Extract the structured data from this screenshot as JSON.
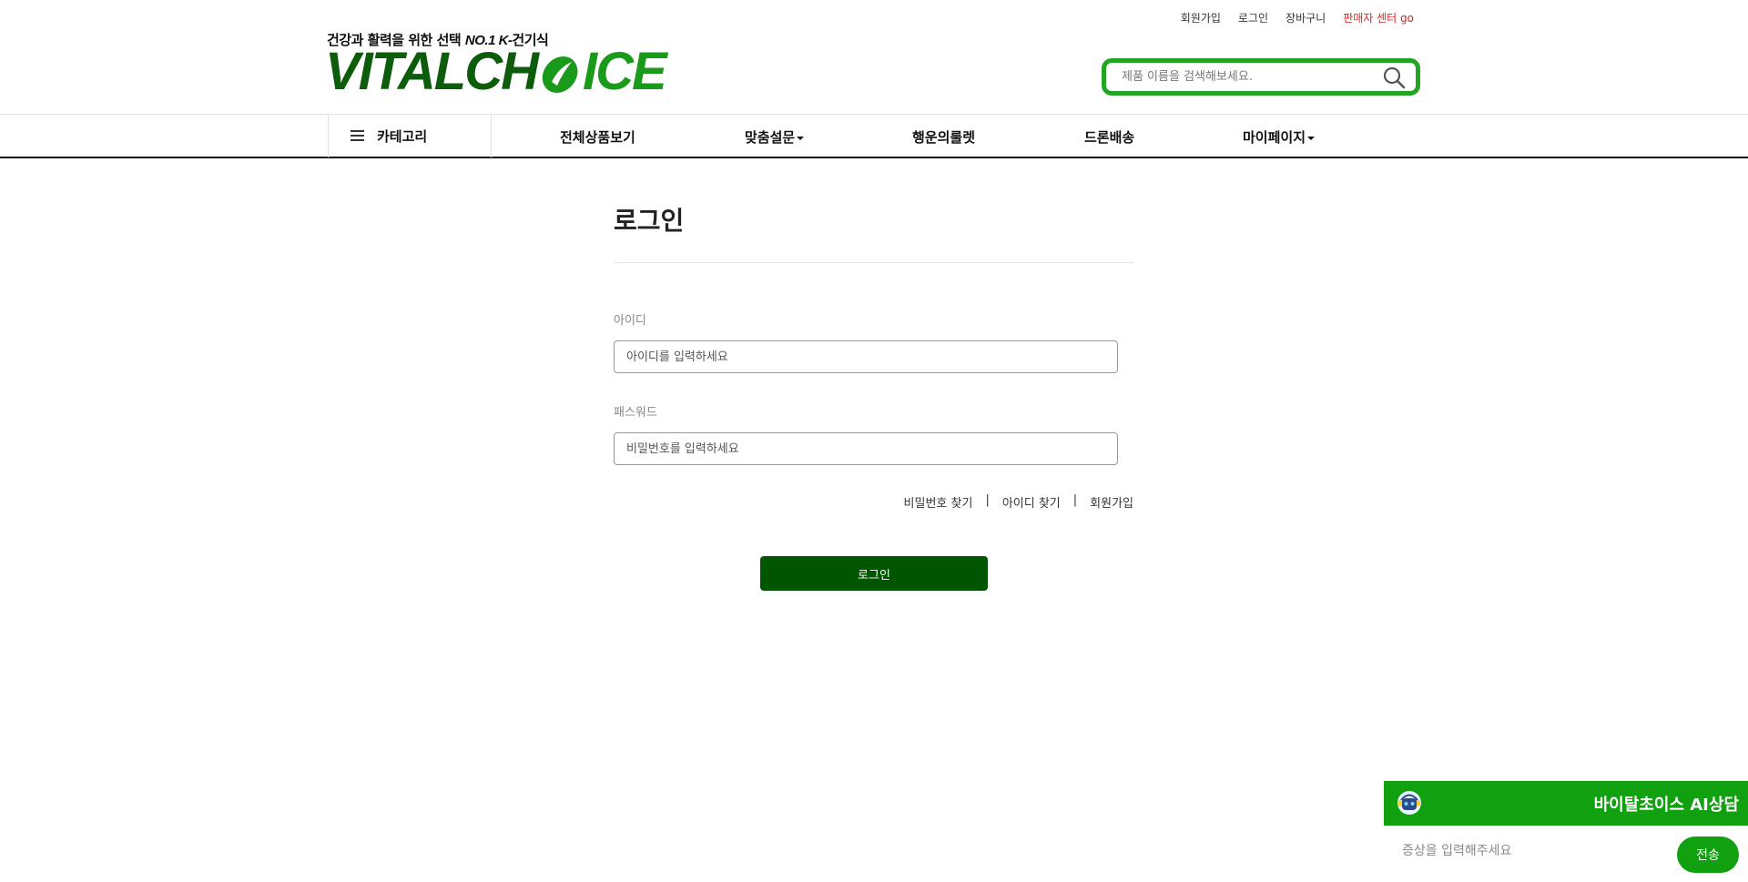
{
  "util_links": {
    "signup": "회원가입",
    "login": "로그인",
    "cart": "장바구니",
    "seller_center": "판매자 센터 go"
  },
  "brand": {
    "tagline_prefix": "건강과 활력을 위한 선택",
    "tagline_no1": "NO.1 K-",
    "tagline_suffix": "건기식",
    "logo_part1": "VITALCH",
    "logo_part2": "ICE",
    "primary_color": "#1a9a1a",
    "dark_color": "#005500"
  },
  "search": {
    "placeholder": "제품 이름을 검색해보세요.",
    "icon": "search-icon"
  },
  "nav": {
    "category": "카테고리",
    "items": [
      "전체상품보기",
      "맞춤설문",
      "행운의룰렛",
      "드론배송",
      "마이페이지"
    ]
  },
  "login": {
    "title": "로그인",
    "id_label": "아이디",
    "id_placeholder": "아이디를 입력하세요",
    "pw_label": "패스워드",
    "pw_placeholder": "비밀번호를 입력하세요",
    "find_password": "비밀번호 찾기",
    "find_id": "아이디 찾기",
    "signup": "회원가입",
    "separator": "|",
    "submit": "로그인"
  },
  "chat": {
    "title": "바이탈초이스 AI상담",
    "placeholder": "증상을 입력해주세요",
    "send": "전송",
    "icon": "robot-icon"
  }
}
